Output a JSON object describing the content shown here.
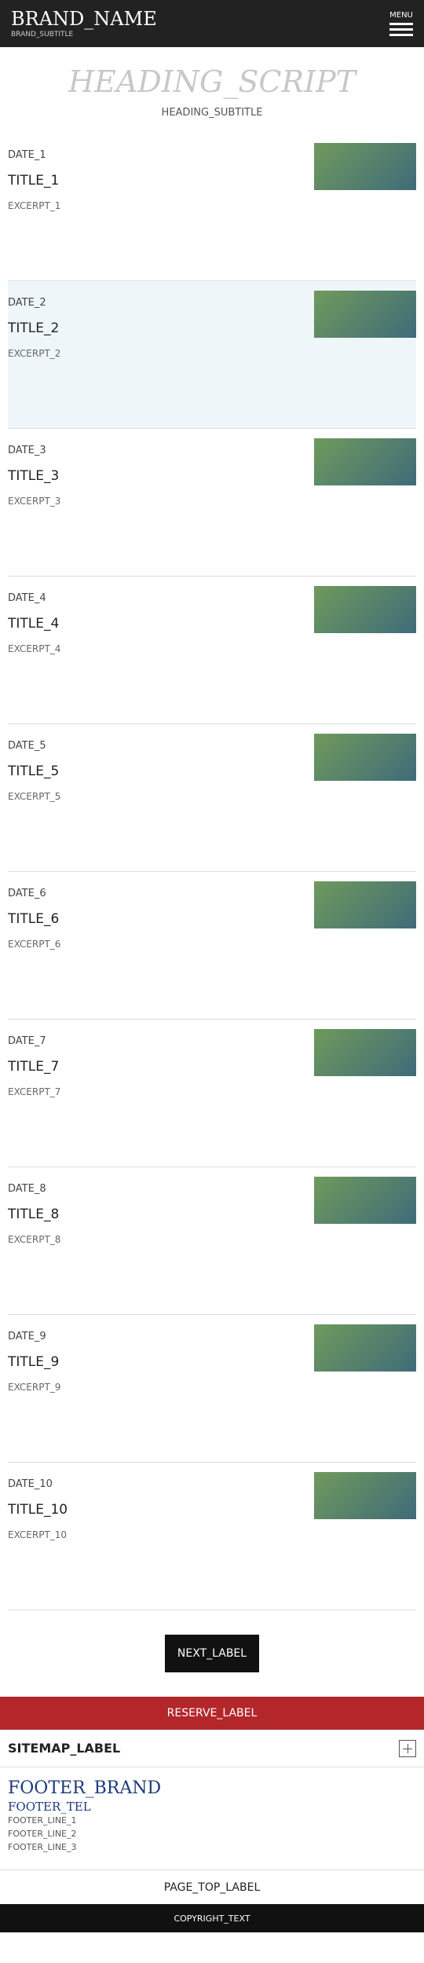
{
  "header": {
    "brand_name": "BRAND_NAME",
    "brand_sub": "BRAND_SUBTITLE",
    "menu_label": "MENU"
  },
  "heading": {
    "script": "HEADING_SCRIPT",
    "sub": "HEADING_SUBTITLE"
  },
  "news": [
    {
      "date": "DATE_1",
      "title": "TITLE_1",
      "excerpt": "EXCERPT_1"
    },
    {
      "date": "DATE_2",
      "title": "TITLE_2",
      "excerpt": "EXCERPT_2"
    },
    {
      "date": "DATE_3",
      "title": "TITLE_3",
      "excerpt": "EXCERPT_3"
    },
    {
      "date": "DATE_4",
      "title": "TITLE_4",
      "excerpt": "EXCERPT_4"
    },
    {
      "date": "DATE_5",
      "title": "TITLE_5",
      "excerpt": "EXCERPT_5"
    },
    {
      "date": "DATE_6",
      "title": "TITLE_6",
      "excerpt": "EXCERPT_6"
    },
    {
      "date": "DATE_7",
      "title": "TITLE_7",
      "excerpt": "EXCERPT_7"
    },
    {
      "date": "DATE_8",
      "title": "TITLE_8",
      "excerpt": "EXCERPT_8"
    },
    {
      "date": "DATE_9",
      "title": "TITLE_9",
      "excerpt": "EXCERPT_9"
    },
    {
      "date": "DATE_10",
      "title": "TITLE_10",
      "excerpt": "EXCERPT_10"
    }
  ],
  "pager": {
    "next_label": "NEXT_LABEL"
  },
  "reserve": {
    "label": "RESERVE_LABEL"
  },
  "sitemap": {
    "label": "SITEMAP_LABEL"
  },
  "footer": {
    "brand": "FOOTER_BRAND",
    "tel": "FOOTER_TEL",
    "line1": "FOOTER_LINE_1",
    "line2": "FOOTER_LINE_2",
    "line3": "FOOTER_LINE_3"
  },
  "page_top": {
    "label": "PAGE_TOP_LABEL"
  },
  "copyright": {
    "text": "COPYRIGHT_TEXT"
  },
  "colors": {
    "header_bg": "#222222",
    "reserve_bg": "#b3272b",
    "footer_brand": "#1d3a7a"
  }
}
